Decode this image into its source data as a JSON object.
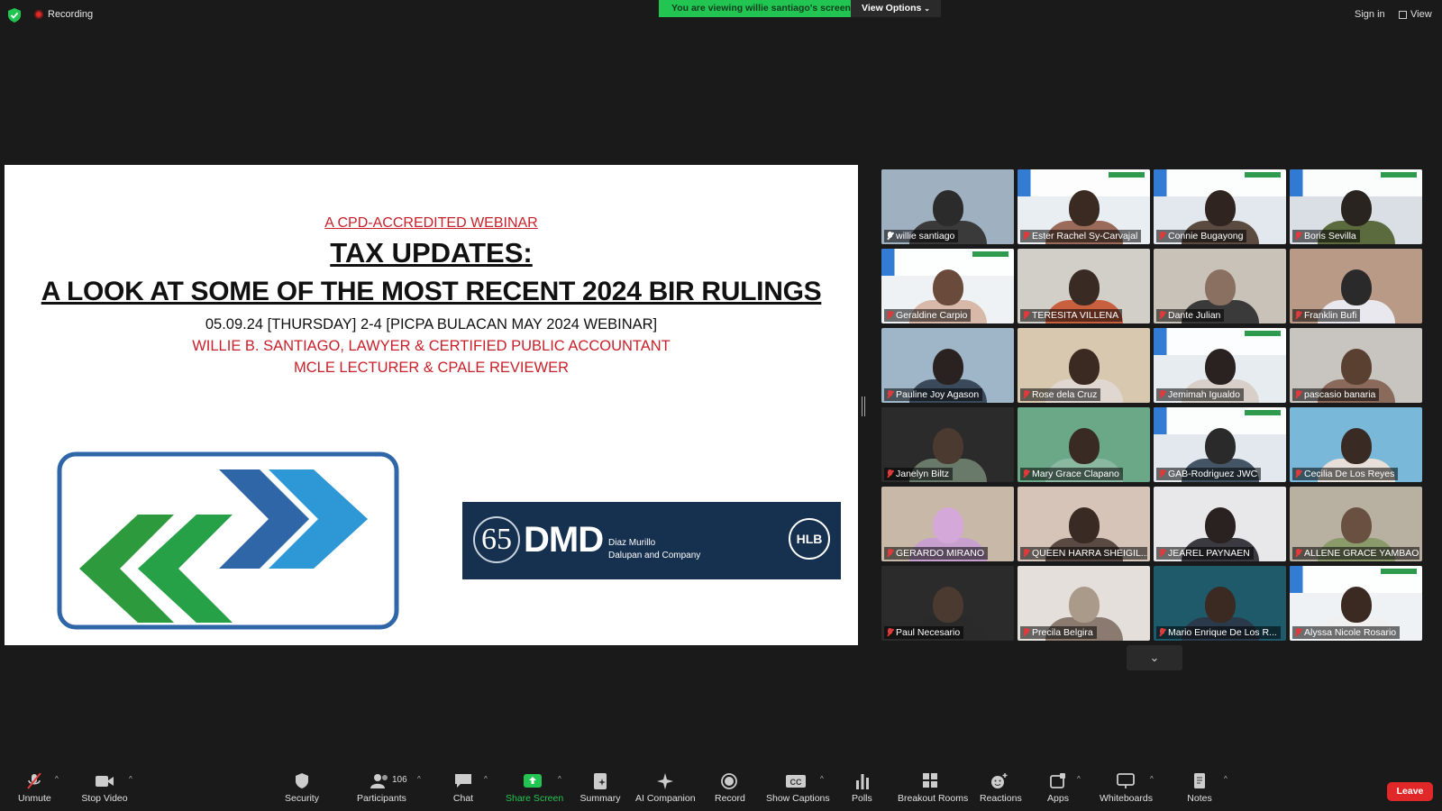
{
  "top": {
    "recording": "Recording",
    "viewing_banner": "You are viewing willie santiago's screen",
    "view_options": "View Options",
    "sign_in": "Sign in",
    "view": "View"
  },
  "slide": {
    "accredited": "A CPD-ACCREDITED WEBINAR",
    "title1": "TAX UPDATES:",
    "title2": "A LOOK AT SOME OF THE MOST RECENT 2024 BIR RULINGS",
    "date_line": "05.09.24 [THURSDAY] 2-4 [PICPA BULACAN MAY 2024 WEBINAR]",
    "speaker_line": "WILLIE B. SANTIAGO, LAWYER & CERTIFIED PUBLIC ACCOUNTANT",
    "role_line": "MCLE LECTURER & CPALE REVIEWER",
    "sponsor": {
      "anniversary": "65",
      "abbr": "DMD",
      "name_line1": "Diaz Murillo",
      "name_line2": "Dalupan and Company",
      "network": "HLB"
    }
  },
  "participants": [
    {
      "name": "willie santiago",
      "active": true
    },
    {
      "name": "Ester Rachel Sy-Carvajal"
    },
    {
      "name": "Connie Bugayong"
    },
    {
      "name": "Boris Sevilla"
    },
    {
      "name": "Geraldine Carpio"
    },
    {
      "name": "TERESITA VILLENA"
    },
    {
      "name": "Dante Julian"
    },
    {
      "name": "Franklin Bufi"
    },
    {
      "name": "Pauline Joy Agason"
    },
    {
      "name": "Rose dela Cruz"
    },
    {
      "name": "Jemimah Igualdo"
    },
    {
      "name": "pascasio banaria"
    },
    {
      "name": "Janelyn Biltz"
    },
    {
      "name": "Mary Grace Clapano"
    },
    {
      "name": "GAB-Rodriguez JWC"
    },
    {
      "name": "Cecilia De Los Reyes"
    },
    {
      "name": "GERARDO MIRANO"
    },
    {
      "name": "QUEEN HARRA SHEIGIL..."
    },
    {
      "name": "JEAREL PAYNAEN"
    },
    {
      "name": "ALLENE GRACE YAMBAO"
    },
    {
      "name": "Paul Necesario"
    },
    {
      "name": "Precila Belgira"
    },
    {
      "name": "Mario Enrique De Los R..."
    },
    {
      "name": "Alyssa Nicole Rosario"
    }
  ],
  "toolbar": {
    "unmute": "Unmute",
    "stop_video": "Stop Video",
    "security": "Security",
    "participants": "Participants",
    "participant_count": "106",
    "chat": "Chat",
    "share_screen": "Share Screen",
    "summary": "Summary",
    "ai_companion": "AI Companion",
    "record": "Record",
    "show_captions": "Show Captions",
    "polls": "Polls",
    "breakout_rooms": "Breakout Rooms",
    "reactions": "Reactions",
    "apps": "Apps",
    "whiteboards": "Whiteboards",
    "notes": "Notes",
    "leave": "Leave"
  },
  "colors": {
    "banner_green": "#23c552",
    "leave_red": "#e02828",
    "slide_red": "#c8202a",
    "active_outline": "#f2d43b"
  }
}
